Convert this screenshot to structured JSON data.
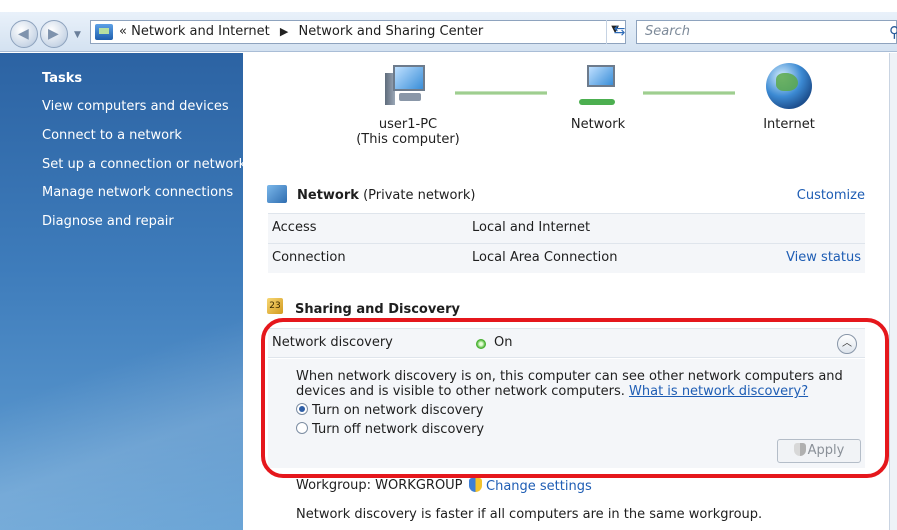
{
  "address_bar": {
    "crumbs": [
      "Network and Internet",
      "Network and Sharing Center"
    ],
    "overflow": "«",
    "search_placeholder": "Search"
  },
  "sidebar": {
    "title": "Tasks",
    "items": [
      {
        "label": "View computers and devices"
      },
      {
        "label": "Connect to a network"
      },
      {
        "label": "Set up a connection or network"
      },
      {
        "label": "Manage network connections"
      },
      {
        "label": "Diagnose and repair"
      }
    ]
  },
  "map": {
    "computer_name": "user1-PC",
    "computer_sub": "(This computer)",
    "network_label": "Network",
    "internet_label": "Internet"
  },
  "network": {
    "name": "Network",
    "type": "(Private network)",
    "customize": "Customize",
    "rows": [
      {
        "key": "Access",
        "value": "Local and Internet",
        "link": ""
      },
      {
        "key": "Connection",
        "value": "Local Area Connection",
        "link": "View status"
      }
    ]
  },
  "sharing": {
    "title": "Sharing and Discovery",
    "icon_text": "23",
    "discovery_label": "Network discovery",
    "discovery_state": "On",
    "description": "When network discovery is on, this computer can see other network computers and devices and is visible to other network computers.",
    "help_link": "What is network discovery?",
    "options": [
      {
        "label": "Turn on network discovery",
        "selected": true
      },
      {
        "label": "Turn off network discovery",
        "selected": false
      }
    ],
    "apply": "Apply",
    "workgroup": "Workgroup: WORKGROUP",
    "change_settings": "Change settings",
    "footer_note": "Network discovery is faster if all computers are in the same workgroup."
  },
  "colors": {
    "sidebar": "#3e7cbb",
    "link": "#1e5db4",
    "highlight": "#e5171c",
    "status_on": "#45b02e"
  }
}
